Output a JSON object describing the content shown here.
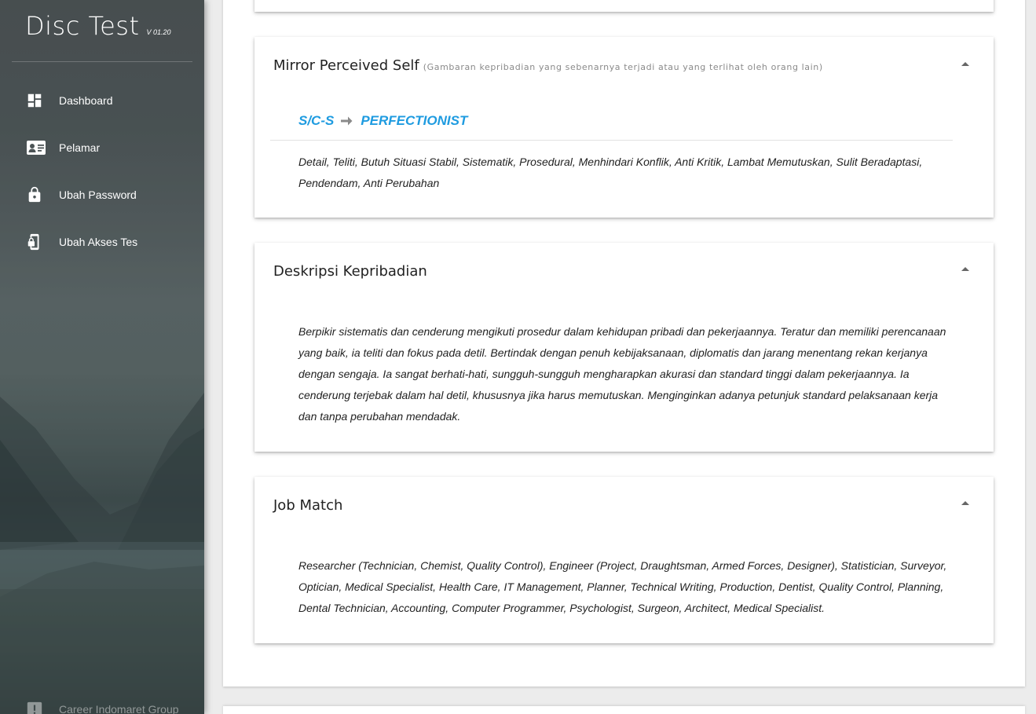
{
  "app": {
    "name": "Disc Test",
    "version": "V 01.20"
  },
  "nav": {
    "items": [
      {
        "label": "Dashboard",
        "icon": "dashboard-icon"
      },
      {
        "label": "Pelamar",
        "icon": "id-card-icon"
      },
      {
        "label": "Ubah Password",
        "icon": "lock-icon"
      },
      {
        "label": "Ubah Akses Tes",
        "icon": "phone-lock-icon"
      }
    ],
    "footer": {
      "label": "Career Indomaret Group",
      "icon": "alert-icon"
    }
  },
  "panels": {
    "mirror": {
      "title": "Mirror Perceived Self",
      "subtitle": "(Gambaran kepribadian yang sebenarnya terjadi atau yang terlihat oleh orang lain)",
      "type_code": "S/C-S",
      "type_name": "PERFECTIONIST",
      "traits": "Detail, Teliti, Butuh Situasi Stabil, Sistematik, Prosedural, Menhindari Konflik, Anti Kritik, Lambat Memutuskan, Sulit Beradaptasi, Pendendam, Anti Perubahan"
    },
    "description": {
      "title": "Deskripsi Kepribadian",
      "body": "Berpikir sistematis dan cenderung mengikuti prosedur dalam kehidupan pribadi dan pekerjaannya.  Teratur dan memiliki perencanaan yang baik, ia teliti dan fokus pada detil.  Bertindak dengan penuh kebijaksanaan, diplomatis dan jarang menentang rekan kerjanya dengan sengaja.  Ia sangat berhati-hati, sungguh-sungguh mengharapkan akurasi dan standard tinggi dalam pekerjaannya.  Ia cenderung terjebak dalam hal detil, khususnya jika harus memutuskan.  Menginginkan adanya petunjuk standard pelaksanaan kerja dan tanpa perubahan mendadak."
    },
    "job_match": {
      "title": "Job Match",
      "body": "Researcher (Technician, Chemist, Quality Control), Engineer (Project, Draughtsman, Armed Forces, Designer), Statistician, Surveyor, Optician, Medical Specialist, Health Care, IT Management, Planner, Technical Writing, Production, Dentist, Quality Control, Planning, Dental Technician, Accounting, Computer Programmer, Psychologist, Surgeon, Architect, Medical Specialist."
    }
  },
  "colors": {
    "accent": "#1e9be0",
    "sidebar_text": "#ffffff",
    "page_background": "#ececec"
  }
}
